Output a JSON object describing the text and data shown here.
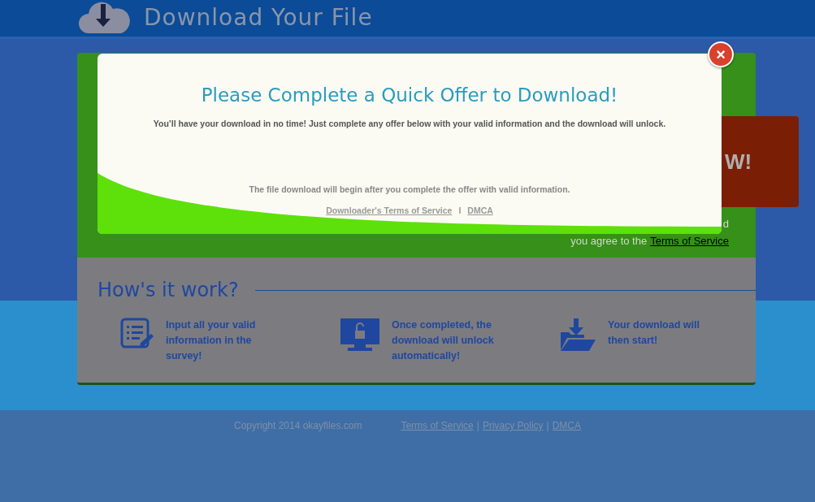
{
  "header": {
    "title": "Download Your File"
  },
  "offer_panel": {
    "button_label": "W!",
    "note_tail": "d",
    "note": "you agree to the",
    "note_link": "Terms of Service"
  },
  "how_it_works": {
    "title": "How's it work?",
    "steps": [
      {
        "kind": "survey",
        "text": "Input all your valid information in the survey!"
      },
      {
        "kind": "unlock",
        "text": "Once completed, the download will unlock automatically!"
      },
      {
        "kind": "download",
        "text": "Your download will then start!"
      }
    ]
  },
  "footer": {
    "copyright": "Copyright 2014 okayfiles.com",
    "links": [
      "Terms of Service",
      "Privacy Policy",
      "DMCA"
    ],
    "separators": [
      "|",
      "|"
    ]
  },
  "modal": {
    "title": "Please Complete a Quick Offer to Download!",
    "subtitle": "You’ll have your download in no time! Just complete any offer below with your valid information and the download will unlock.",
    "note": "The file download will begin after you complete the offer with valid information.",
    "links": [
      "Downloader's Terms of Service",
      "DMCA"
    ],
    "separator": "I",
    "close_label": "×"
  }
}
